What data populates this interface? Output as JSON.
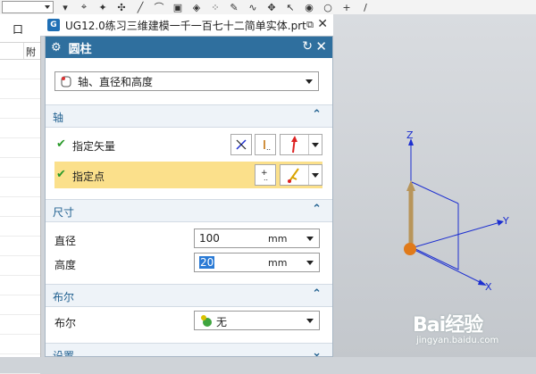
{
  "window": {
    "title": "UG12.0练习三维建模一千一百七十二简单实体.prt"
  },
  "left_panel": {
    "button": "口",
    "col_header": "附"
  },
  "dialog": {
    "title": "圆柱",
    "type_value": "轴、直径和高度",
    "sections": {
      "axis": "轴",
      "dimensions": "尺寸",
      "boolean": "布尔",
      "settings": "设置"
    },
    "axis": {
      "vector_label": "指定矢量",
      "point_label": "指定点"
    },
    "dimensions": {
      "diameter_label": "直径",
      "diameter_value": "100",
      "diameter_unit": "mm",
      "height_label": "高度",
      "height_value": "20",
      "height_unit": "mm"
    },
    "boolean": {
      "label": "布尔",
      "value": "无"
    }
  },
  "graphics": {
    "axis_x": "X",
    "axis_y": "Y",
    "axis_z": "Z"
  },
  "watermark": {
    "logo": "Bai经验",
    "url": "jingyan.baidu.com"
  },
  "colors": {
    "dialog_header": "#2f6f9e",
    "highlight_row": "#fbe08b",
    "axis_blue": "#1d2fd0",
    "vector_brown": "#b8955a",
    "origin_orange": "#e07a1a"
  }
}
